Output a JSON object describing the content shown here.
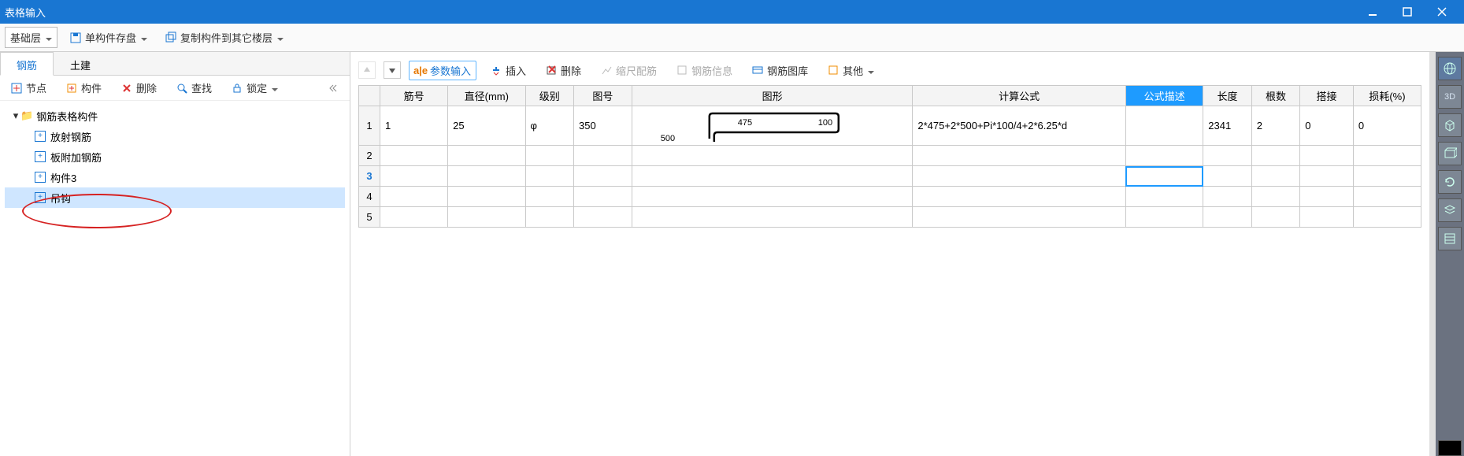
{
  "window": {
    "title": "表格输入"
  },
  "toolbar": {
    "layer_dropdown": "基础层",
    "save_single": "单构件存盘",
    "copy_floors": "复制构件到其它楼层"
  },
  "left": {
    "tabs": {
      "rebar": "钢筋",
      "civil": "土建"
    },
    "actions": {
      "node": "节点",
      "component": "构件",
      "delete": "删除",
      "find": "查找",
      "lock": "锁定"
    },
    "tree": {
      "root": "钢筋表格构件",
      "items": [
        "放射钢筋",
        "板附加钢筋",
        "构件3",
        "吊钩"
      ],
      "selected_index": 3
    }
  },
  "grid_toolbar": {
    "param_input": "参数输入",
    "insert": "插入",
    "delete": "删除",
    "scale": "缩尺配筋",
    "info": "钢筋信息",
    "library": "钢筋图库",
    "other": "其他"
  },
  "grid": {
    "headers": [
      "筋号",
      "直径(mm)",
      "级别",
      "图号",
      "图形",
      "计算公式",
      "公式描述",
      "长度",
      "根数",
      "搭接",
      "损耗(%)"
    ],
    "selected_header_index": 6,
    "selected_row_index": 2,
    "selected_cell": {
      "row": 2,
      "col": 6
    },
    "rows": [
      {
        "jinhao": "1",
        "diameter": "25",
        "grade": "φ",
        "shape_no": "350",
        "shape": {
          "left_leg": "500",
          "mid": "475",
          "right_leg": "100"
        },
        "formula": "2*475+2*500+Pi*100/4+2*6.25*d",
        "desc": "",
        "length": "2341",
        "count": "2",
        "overlap": "0",
        "loss": "0"
      },
      {},
      {},
      {},
      {}
    ]
  },
  "dock": {
    "items": [
      "globe",
      "3D",
      "cube",
      "box",
      "refresh",
      "layers",
      "settings",
      "bottom"
    ]
  }
}
